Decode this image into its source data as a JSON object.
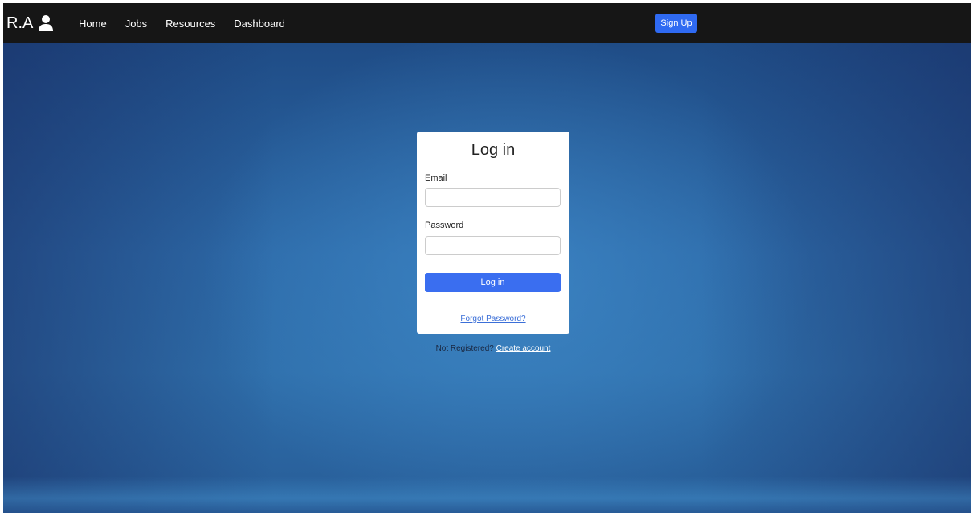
{
  "header": {
    "brand": "R.A",
    "brand_icon": "user-icon",
    "nav": [
      "Home",
      "Jobs",
      "Resources",
      "Dashboard"
    ],
    "signup_label": "Sign Up"
  },
  "login": {
    "title": "Log in",
    "email_label": "Email",
    "email_value": "",
    "password_label": "Password",
    "password_value": "",
    "submit_label": "Log in",
    "forgot_label": "Forgot Password?"
  },
  "register": {
    "prefix": "Not Registered?",
    "link_label": "Create account"
  },
  "colors": {
    "navbar": "#161616",
    "accent": "#2f6af2",
    "background": "#2d6aa8",
    "link": "#3b6fd8"
  }
}
